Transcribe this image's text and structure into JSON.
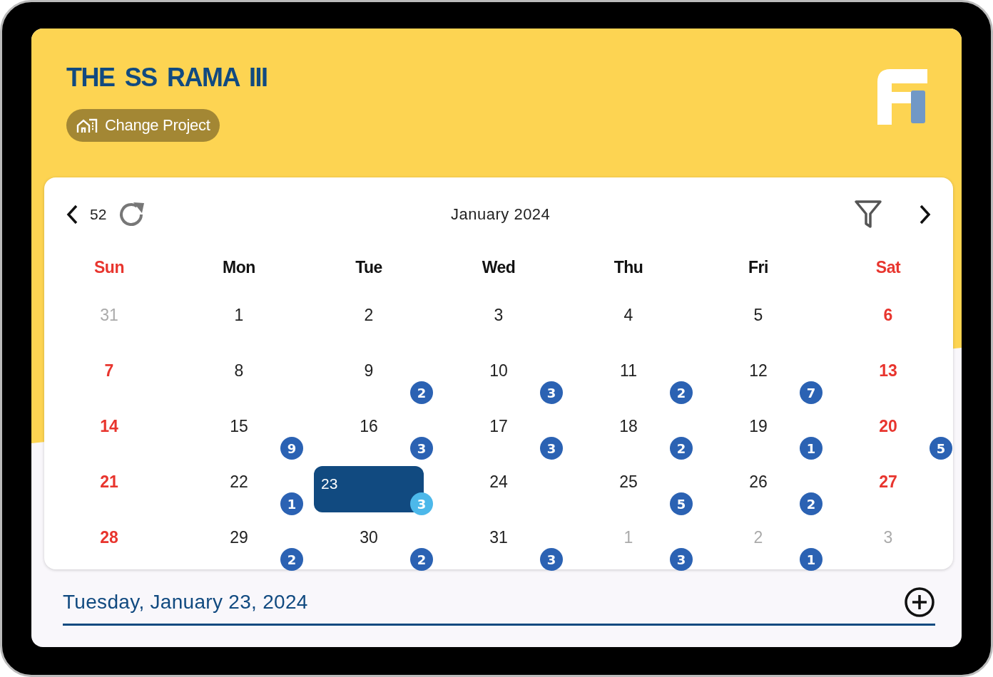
{
  "header": {
    "title": "THE SS RAMA III",
    "change_project": "Change Project"
  },
  "calendar": {
    "week_number": "52",
    "month": "January 2024",
    "weekdays": [
      {
        "label": "Sun",
        "kind": "weekend"
      },
      {
        "label": "Mon",
        "kind": "normal"
      },
      {
        "label": "Tue",
        "kind": "normal"
      },
      {
        "label": "Wed",
        "kind": "normal"
      },
      {
        "label": "Thu",
        "kind": "normal"
      },
      {
        "label": "Fri",
        "kind": "normal"
      },
      {
        "label": "Sat",
        "kind": "weekend"
      }
    ],
    "weeks": [
      {
        "days": [
          {
            "day": "31",
            "kind": "muted",
            "selected": false
          },
          {
            "day": "1",
            "kind": "normal",
            "selected": false
          },
          {
            "day": "2",
            "kind": "normal",
            "selected": false
          },
          {
            "day": "3",
            "kind": "normal",
            "selected": false
          },
          {
            "day": "4",
            "kind": "normal",
            "selected": false
          },
          {
            "day": "5",
            "kind": "normal",
            "selected": false
          },
          {
            "day": "6",
            "kind": "weekend",
            "selected": false
          }
        ]
      },
      {
        "days": [
          {
            "day": "7",
            "kind": "weekend",
            "selected": false
          },
          {
            "day": "8",
            "kind": "normal",
            "selected": false
          },
          {
            "day": "9",
            "kind": "normal",
            "selected": false,
            "count": "2"
          },
          {
            "day": "10",
            "kind": "normal",
            "selected": false,
            "count": "3"
          },
          {
            "day": "11",
            "kind": "normal",
            "selected": false,
            "count": "2"
          },
          {
            "day": "12",
            "kind": "normal",
            "selected": false,
            "count": "7"
          },
          {
            "day": "13",
            "kind": "weekend",
            "selected": false
          }
        ]
      },
      {
        "days": [
          {
            "day": "14",
            "kind": "weekend",
            "selected": false
          },
          {
            "day": "15",
            "kind": "normal",
            "selected": false,
            "count": "9"
          },
          {
            "day": "16",
            "kind": "normal",
            "selected": false,
            "count": "3"
          },
          {
            "day": "17",
            "kind": "normal",
            "selected": false,
            "count": "3"
          },
          {
            "day": "18",
            "kind": "normal",
            "selected": false,
            "count": "2"
          },
          {
            "day": "19",
            "kind": "normal",
            "selected": false,
            "count": "1"
          },
          {
            "day": "20",
            "kind": "weekend",
            "selected": false,
            "count": "5"
          }
        ]
      },
      {
        "days": [
          {
            "day": "21",
            "kind": "weekend",
            "selected": false
          },
          {
            "day": "22",
            "kind": "normal",
            "selected": false,
            "count": "1"
          },
          {
            "day": "23",
            "kind": "normal",
            "selected": true,
            "count": "3"
          },
          {
            "day": "24",
            "kind": "normal",
            "selected": false
          },
          {
            "day": "25",
            "kind": "normal",
            "selected": false,
            "count": "5"
          },
          {
            "day": "26",
            "kind": "normal",
            "selected": false,
            "count": "2"
          },
          {
            "day": "27",
            "kind": "weekend",
            "selected": false
          }
        ]
      },
      {
        "days": [
          {
            "day": "28",
            "kind": "weekend",
            "selected": false
          },
          {
            "day": "29",
            "kind": "normal",
            "selected": false,
            "count": "2"
          },
          {
            "day": "30",
            "kind": "normal",
            "selected": false,
            "count": "2"
          },
          {
            "day": "31",
            "kind": "normal",
            "selected": false,
            "count": "3"
          },
          {
            "day": "1",
            "kind": "muted",
            "selected": false,
            "count": "3"
          },
          {
            "day": "2",
            "kind": "muted",
            "selected": false,
            "count": "1"
          },
          {
            "day": "3",
            "kind": "muted",
            "selected": false
          }
        ]
      }
    ]
  },
  "footer": {
    "selected_date": "Tuesday, January 23, 2024"
  }
}
